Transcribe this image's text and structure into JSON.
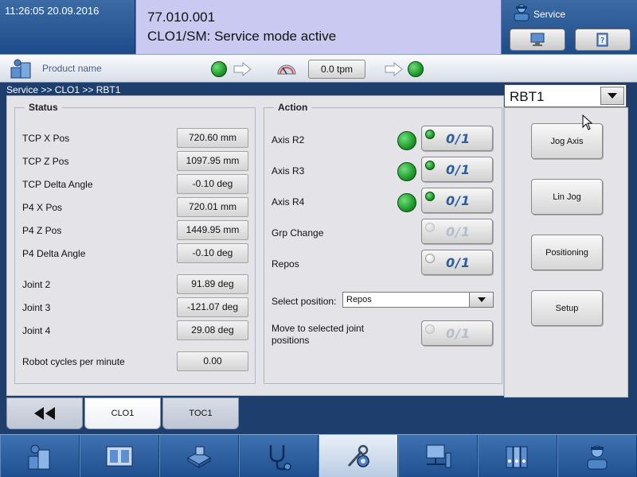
{
  "header": {
    "datetime": "11:26:05 20.09.2016",
    "message_code": "77.010.001",
    "message_text": "CLO1/SM: Service mode active",
    "service_label": "Service"
  },
  "toolbar": {
    "product_name": "Product name",
    "tpm_value": "0.0 tpm"
  },
  "breadcrumb": "Service >> CLO1 >> RBT1",
  "status": {
    "title": "Status",
    "rows": [
      {
        "label": "TCP X Pos",
        "value": "720.60 mm"
      },
      {
        "label": "TCP Z Pos",
        "value": "1097.95 mm"
      },
      {
        "label": "TCP Delta Angle",
        "value": "-0.10 deg"
      },
      {
        "label": "P4 X Pos",
        "value": "720.01 mm"
      },
      {
        "label": "P4 Z Pos",
        "value": "1449.95 mm"
      },
      {
        "label": "P4 Delta Angle",
        "value": "-0.10 deg"
      },
      {
        "label": "Joint 2",
        "value": "91.89 deg"
      },
      {
        "label": "Joint 3",
        "value": "-121.07 deg"
      },
      {
        "label": "Joint 4",
        "value": "29.08 deg"
      },
      {
        "label": "Robot cycles per minute",
        "value": "0.00"
      }
    ]
  },
  "action": {
    "title": "Action",
    "toggle_label": "0/1",
    "rows": [
      {
        "label": "Axis R2"
      },
      {
        "label": "Axis R3"
      },
      {
        "label": "Axis R4"
      },
      {
        "label": "Grp Change"
      },
      {
        "label": "Repos"
      }
    ],
    "select_label": "Select position:",
    "select_value": "Repos",
    "move_label_line1": "Move to selected joint",
    "move_label_line2": "positions"
  },
  "right": {
    "dropdown_value": "RBT1",
    "buttons": [
      "Jog Axis",
      "Lin Jog",
      "Positioning",
      "Setup"
    ]
  },
  "tabs": [
    "CLO1",
    "TOC1"
  ],
  "colors": {
    "led_green": "#1f9a2b",
    "message_bg": "#c9c9f2",
    "header_blue": "#1d4c8a"
  }
}
